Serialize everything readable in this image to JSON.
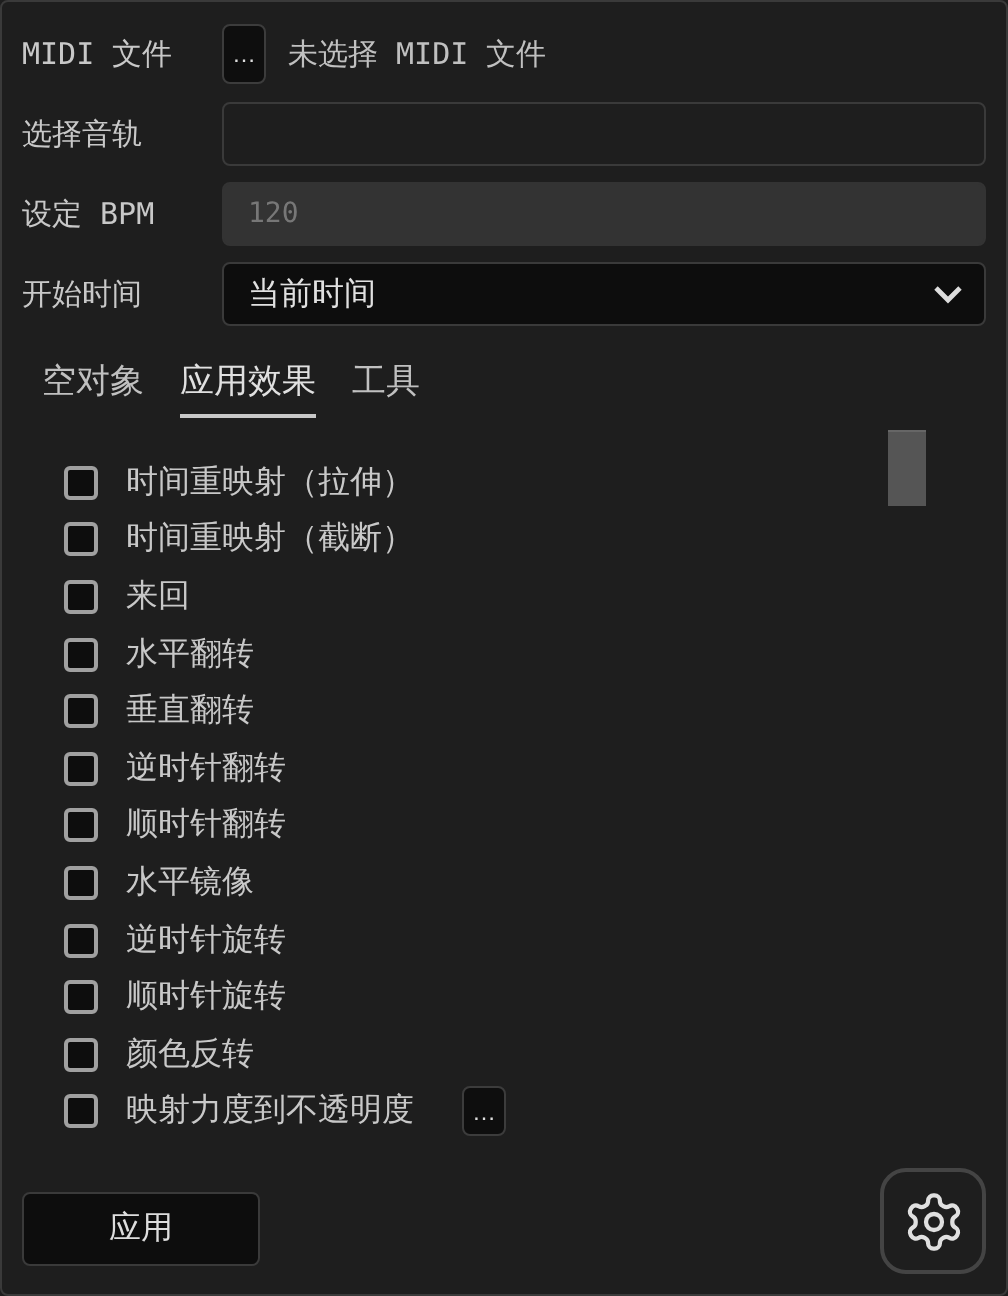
{
  "form": {
    "midi_file": {
      "label": "MIDI 文件",
      "browse": "…",
      "status": "未选择 MIDI 文件"
    },
    "track": {
      "label": "选择音轨"
    },
    "bpm": {
      "label": "设定 BPM",
      "value": "120",
      "disabled": true
    },
    "start_time": {
      "label": "开始时间",
      "value": "当前时间"
    }
  },
  "tabs": [
    {
      "label": "空对象",
      "selected": false
    },
    {
      "label": "应用效果",
      "selected": true
    },
    {
      "label": "工具",
      "selected": false
    }
  ],
  "effects": [
    {
      "label": "时间重映射（拉伸）",
      "checked": false
    },
    {
      "label": "时间重映射（截断）",
      "checked": false
    },
    {
      "label": "来回",
      "checked": false
    },
    {
      "label": "水平翻转",
      "checked": false
    },
    {
      "label": "垂直翻转",
      "checked": false
    },
    {
      "label": "逆时针翻转",
      "checked": false
    },
    {
      "label": "顺时针翻转",
      "checked": false
    },
    {
      "label": "水平镜像",
      "checked": false
    },
    {
      "label": "逆时针旋转",
      "checked": false
    },
    {
      "label": "顺时针旋转",
      "checked": false
    },
    {
      "label": "颜色反转",
      "checked": false
    },
    {
      "label": "映射力度到不透明度",
      "checked": false,
      "options": "…"
    }
  ],
  "apply_button": "应用"
}
